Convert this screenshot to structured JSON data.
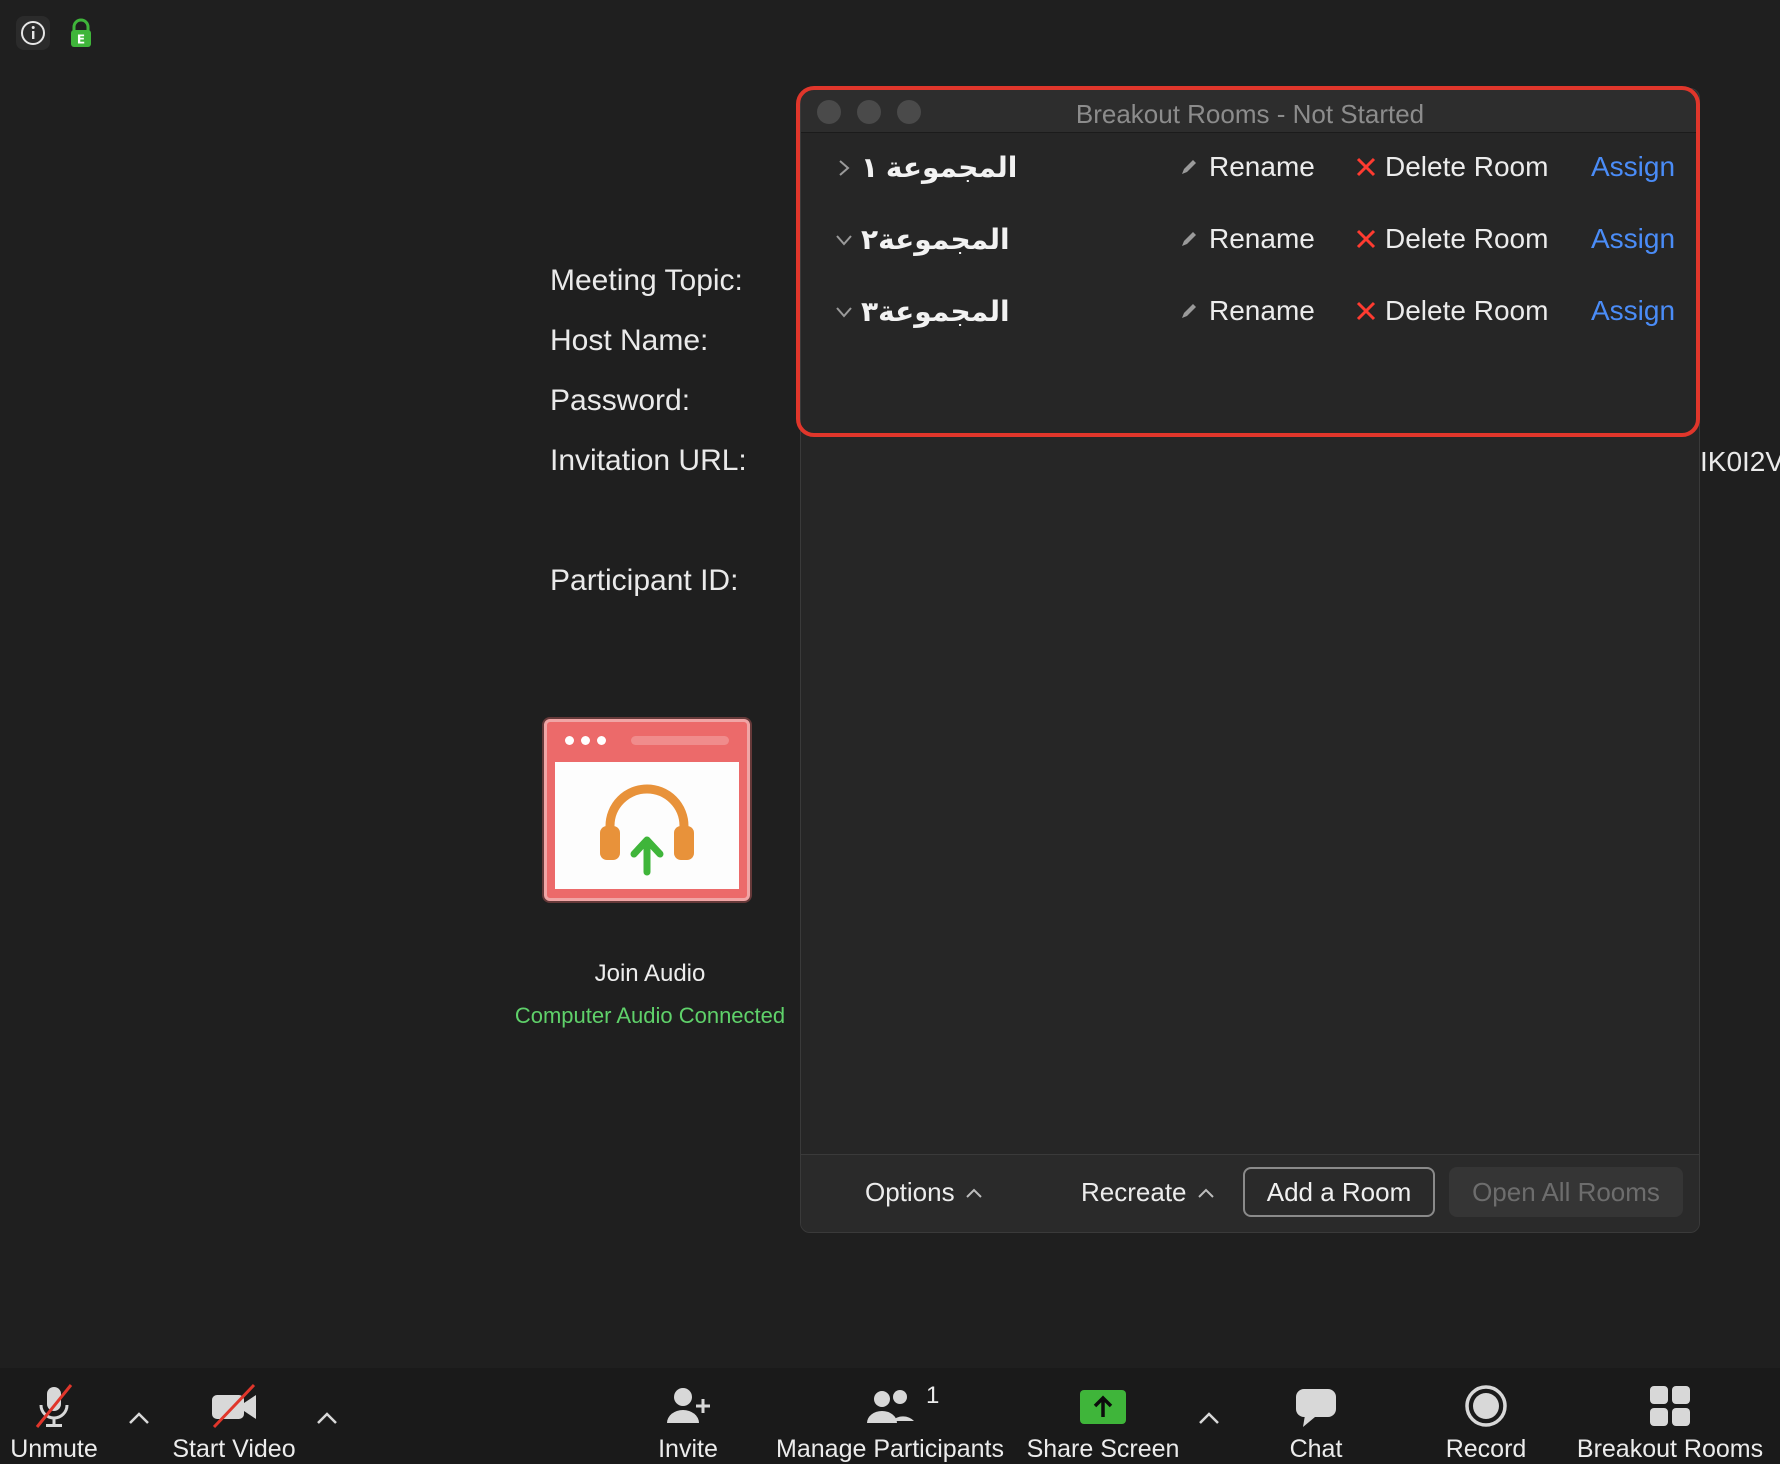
{
  "meeting_info": {
    "topic_label": "Meeting Topic:",
    "host_label": "Host Name:",
    "password_label": "Password:",
    "url_label": "Invitation URL:",
    "url_value_visible": "IK0I2V",
    "participant_label": "Participant ID:"
  },
  "audio": {
    "join_label": "Join Audio",
    "status": "Computer Audio Connected"
  },
  "breakout_window": {
    "title": "Breakout Rooms - Not Started",
    "rooms": [
      {
        "name": "المجموعة ١",
        "rename": "Rename",
        "delete": "Delete Room",
        "assign": "Assign",
        "expanded": false
      },
      {
        "name": "المجموعة٢",
        "rename": "Rename",
        "delete": "Delete Room",
        "assign": "Assign",
        "expanded": true
      },
      {
        "name": "المجموعة٣",
        "rename": "Rename",
        "delete": "Delete Room",
        "assign": "Assign",
        "expanded": true
      }
    ],
    "footer": {
      "options": "Options",
      "recreate": "Recreate",
      "add_room": "Add a Room",
      "open_all": "Open All Rooms"
    }
  },
  "toolbar": {
    "unmute": "Unmute",
    "start_video": "Start Video",
    "invite": "Invite",
    "manage_participants": "Manage Participants",
    "participant_count": "1",
    "share_screen": "Share Screen",
    "chat": "Chat",
    "record": "Record",
    "breakout_rooms": "Breakout Rooms"
  },
  "colors": {
    "background": "#1f1f1f",
    "accent_link": "#4a8cf7",
    "delete_x": "#ff3b30",
    "audio_connected": "#5fd16a",
    "highlight_frame": "#e0362b",
    "share_green": "#3fb53a"
  }
}
